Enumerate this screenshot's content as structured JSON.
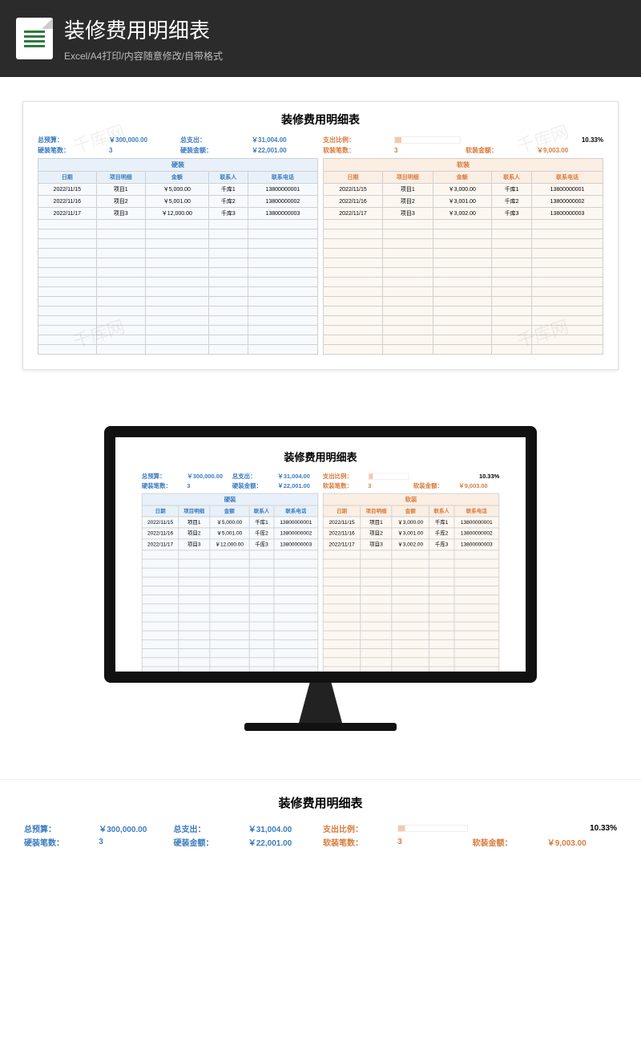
{
  "header": {
    "title": "装修费用明细表",
    "subtitle": "Excel/A4打印/内容随意修改/自带格式"
  },
  "sheet": {
    "title": "装修费用明细表",
    "summary": {
      "budget_label": "总预算：",
      "budget_value": "￥300,000.00",
      "expense_label": "总支出：",
      "expense_value": "￥31,004.00",
      "ratio_label": "支出比例：",
      "ratio_value": "10.33%",
      "hard_count_label": "硬装笔数：",
      "hard_count_value": "3",
      "hard_amount_label": "硬装金额：",
      "hard_amount_value": "￥22,001.00",
      "soft_count_label": "软装笔数：",
      "soft_count_value": "3",
      "soft_amount_label": "软装金额：",
      "soft_amount_value": "￥9,003.00"
    },
    "hard": {
      "section_label": "硬装",
      "columns": [
        "日期",
        "项目明细",
        "金额",
        "联系人",
        "联系电话"
      ],
      "rows": [
        [
          "2022/11/15",
          "项目1",
          "￥5,000.00",
          "千库1",
          "13800000001"
        ],
        [
          "2022/11/16",
          "项目2",
          "￥5,001.00",
          "千库2",
          "13800000002"
        ],
        [
          "2022/11/17",
          "项目3",
          "￥12,000.00",
          "千库3",
          "13800000003"
        ]
      ]
    },
    "soft": {
      "section_label": "软装",
      "columns": [
        "日期",
        "项目明细",
        "金额",
        "联系人",
        "联系电话"
      ],
      "rows": [
        [
          "2022/11/15",
          "项目1",
          "￥3,000.00",
          "千库1",
          "13800000001"
        ],
        [
          "2022/11/16",
          "项目2",
          "￥3,001.00",
          "千库2",
          "13800000002"
        ],
        [
          "2022/11/17",
          "项目3",
          "￥3,002.00",
          "千库3",
          "13800000003"
        ]
      ]
    },
    "empty_rows": 14
  },
  "watermark_text": "千库网",
  "colors": {
    "blue": "#3b7bbf",
    "orange": "#d97b3d",
    "header_bg": "#2b2b2b"
  }
}
